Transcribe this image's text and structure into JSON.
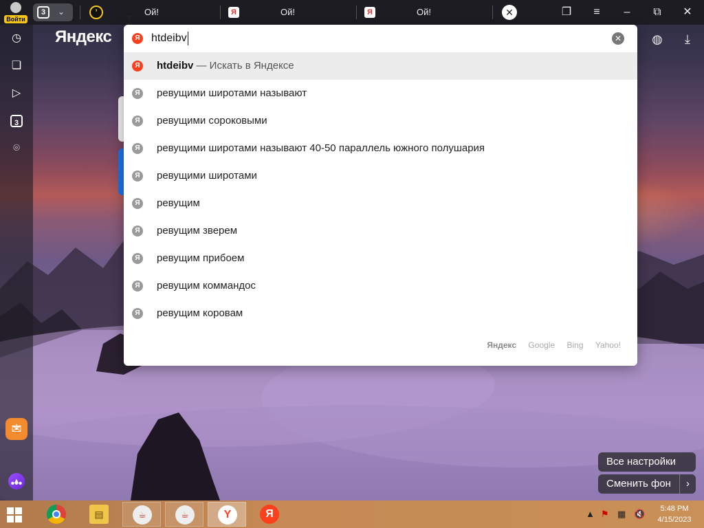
{
  "window": {
    "login_label": "Войти",
    "tab_count": "3",
    "tabs": [
      {
        "title": "Ой!"
      },
      {
        "title": "Ой!"
      },
      {
        "title": "Ой!"
      }
    ]
  },
  "brand": "Яндекс",
  "sidebar": {
    "items": [
      "history-icon",
      "collections-icon",
      "video-icon",
      "tabs-icon",
      "screenshot-icon"
    ],
    "tabs_count": "3"
  },
  "search": {
    "query": "htdeibv",
    "suggestions": [
      {
        "bold": "htdeibv",
        "rest": " — Искать в Яндексе"
      },
      {
        "text": "ревущими широтами называют"
      },
      {
        "text": "ревущими сороковыми"
      },
      {
        "text": "ревущими широтами называют 40-50 параллель южного полушария"
      },
      {
        "text": "ревущими широтами"
      },
      {
        "text": "ревущим"
      },
      {
        "text": "ревущим зверем"
      },
      {
        "text": "ревущим прибоем"
      },
      {
        "text": "ревущим коммандос"
      },
      {
        "text": "ревущим коровам"
      }
    ],
    "engines": [
      "Яндекс",
      "Google",
      "Bing",
      "Yahoo!"
    ]
  },
  "buttons": {
    "all_settings": "Все настройки",
    "change_bg": "Сменить фон"
  },
  "taskbar": {
    "time": "5:48 PM",
    "date": "4/15/2023"
  },
  "colors": {
    "yandex_red": "#fc3f1d",
    "accent_yellow": "#f5c518"
  }
}
